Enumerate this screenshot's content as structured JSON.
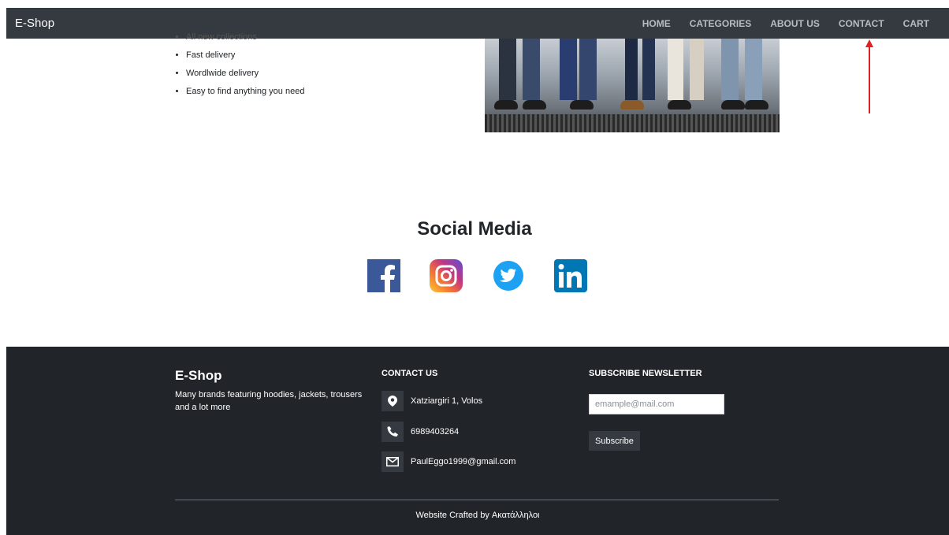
{
  "navbar": {
    "brand": "E-Shop",
    "links": [
      "HOME",
      "CATEGORIES",
      "ABOUT US",
      "CONTACT",
      "CART"
    ]
  },
  "features": {
    "items": [
      "All new collections",
      "Fast delivery",
      "Wordlwide delivery",
      "Easy to find anything you need"
    ]
  },
  "social": {
    "title": "Social Media",
    "icons": [
      "facebook-icon",
      "instagram-icon",
      "twitter-icon",
      "linkedin-icon"
    ],
    "colors": {
      "facebook": "#3b5998",
      "instagram": "#c13584",
      "twitter": "#1da1f2",
      "linkedin": "#0077b5"
    }
  },
  "footer": {
    "brand": "E-Shop",
    "description": "Many brands featuring hoodies, jackets, trousers and a lot more",
    "contact": {
      "heading": "CONTACT US",
      "address": "Xatziargiri 1, Volos",
      "phone": "6989403264",
      "email": "PaulEggo1999@gmail.com"
    },
    "newsletter": {
      "heading": "SUBSCRIBE NEWSLETTER",
      "placeholder": "emample@mail.com",
      "button": "Subscribe"
    },
    "credit": "Website Crafted by Ακατάλληλοι"
  },
  "annotation": {
    "arrow_color": "#e02020"
  }
}
